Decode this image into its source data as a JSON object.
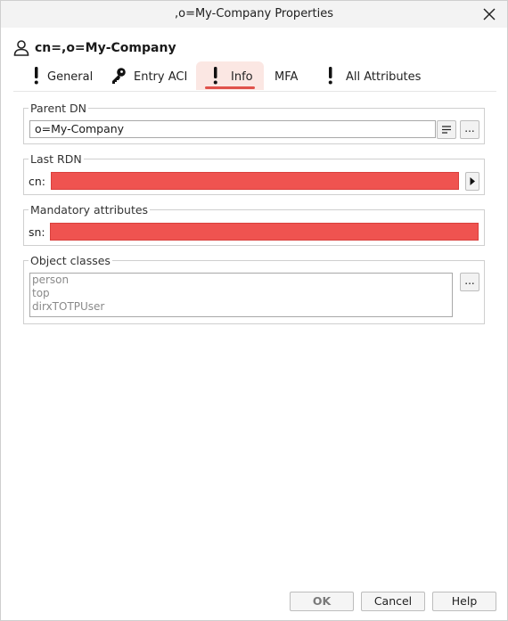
{
  "window": {
    "title": ",o=My-Company Properties"
  },
  "header": {
    "heading": "cn=,o=My-Company",
    "icon": "user-icon"
  },
  "tabs": [
    {
      "label": "General",
      "icon": "exclamation-icon"
    },
    {
      "label": "Entry ACI",
      "icon": "key-icon"
    },
    {
      "label": "Info",
      "icon": "exclamation-icon",
      "active": true
    },
    {
      "label": "MFA"
    },
    {
      "label": "All Attributes",
      "icon": "exclamation-icon"
    }
  ],
  "parent_dn": {
    "legend": "Parent DN",
    "value": "o=My-Company",
    "more_label": "..."
  },
  "last_rdn": {
    "legend": "Last RDN",
    "label": "cn:",
    "value": ""
  },
  "mandatory": {
    "legend": "Mandatory attributes",
    "label": "sn:",
    "value": ""
  },
  "object_classes": {
    "legend": "Object classes",
    "items": [
      "person",
      "top",
      "dirxTOTPUser"
    ],
    "more_label": "..."
  },
  "buttons": {
    "ok": "OK",
    "cancel": "Cancel",
    "help": "Help"
  },
  "colors": {
    "accent": "#e0524b",
    "invalid_field": "#ef5350",
    "active_tab_bg": "#fbe7e3"
  }
}
